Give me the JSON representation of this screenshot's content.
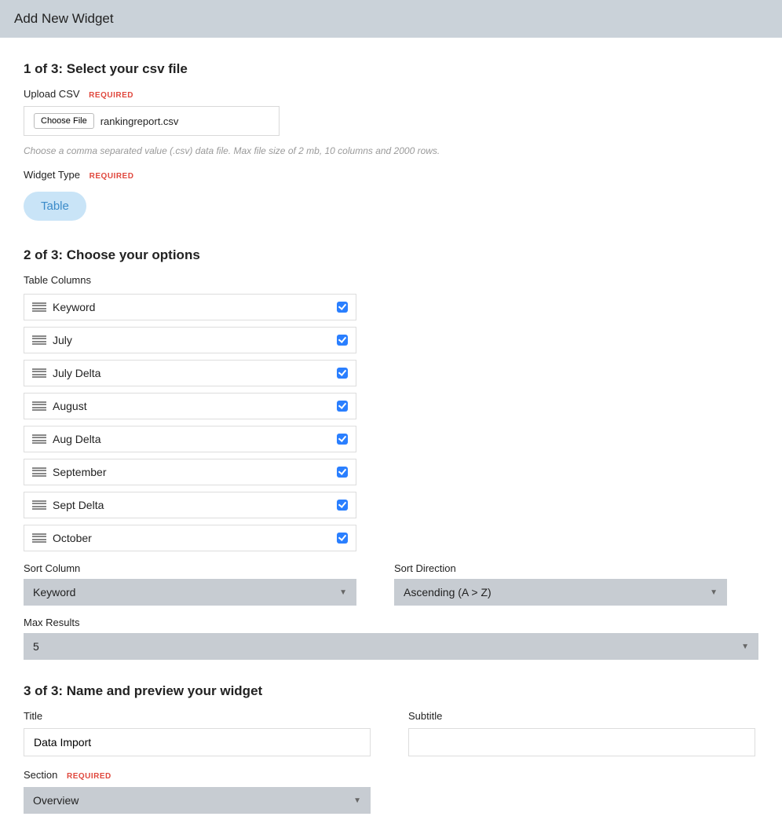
{
  "header": {
    "title": "Add New Widget"
  },
  "step1": {
    "title": "1 of 3: Select your csv file",
    "upload_label": "Upload CSV",
    "required": "REQUIRED",
    "choose_file_label": "Choose File",
    "file_name": "rankingreport.csv",
    "hint": "Choose a comma separated value (.csv) data file. Max file size of 2 mb, 10 columns and 2000 rows.",
    "widget_type_label": "Widget Type",
    "widget_type_value": "Table"
  },
  "step2": {
    "title": "2 of 3: Choose your options",
    "table_columns_label": "Table Columns",
    "columns": [
      {
        "label": "Keyword",
        "checked": true
      },
      {
        "label": "July",
        "checked": true
      },
      {
        "label": "July Delta",
        "checked": true
      },
      {
        "label": "August",
        "checked": true
      },
      {
        "label": "Aug Delta",
        "checked": true
      },
      {
        "label": "September",
        "checked": true
      },
      {
        "label": "Sept Delta",
        "checked": true
      },
      {
        "label": "October",
        "checked": true
      }
    ],
    "sort_column_label": "Sort Column",
    "sort_column_value": "Keyword",
    "sort_direction_label": "Sort Direction",
    "sort_direction_value": "Ascending (A > Z)",
    "max_results_label": "Max Results",
    "max_results_value": "5"
  },
  "step3": {
    "title": "3 of 3: Name and preview your widget",
    "title_label": "Title",
    "title_value": "Data Import",
    "subtitle_label": "Subtitle",
    "subtitle_value": "",
    "section_label": "Section",
    "required": "REQUIRED",
    "section_value": "Overview"
  }
}
